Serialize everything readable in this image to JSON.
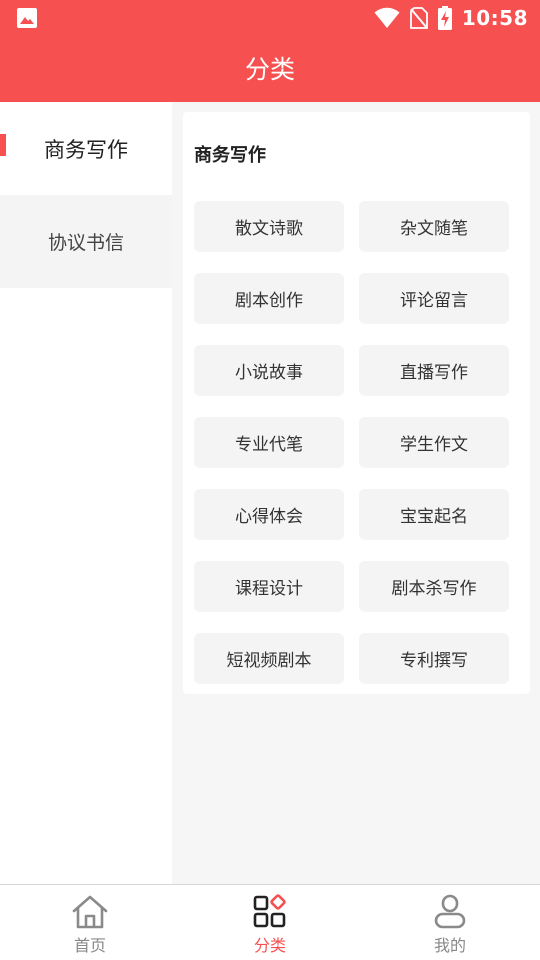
{
  "status_bar": {
    "time": "10:58"
  },
  "header": {
    "title": "分类"
  },
  "sidebar": {
    "items": [
      {
        "label": "商务写作",
        "active": true
      },
      {
        "label": "协议书信",
        "active": false
      }
    ]
  },
  "content": {
    "section_title": "商务写作",
    "tags": [
      "散文诗歌",
      "杂文随笔",
      "剧本创作",
      "评论留言",
      "小说故事",
      "直播写作",
      "专业代笔",
      "学生作文",
      "心得体会",
      "宝宝起名",
      "课程设计",
      "剧本杀写作",
      "短视频剧本",
      "专利撰写"
    ]
  },
  "tabbar": {
    "items": [
      {
        "label": "首页"
      },
      {
        "label": "分类"
      },
      {
        "label": "我的"
      }
    ]
  },
  "colors": {
    "accent": "#f65150",
    "inactive": "#888888"
  }
}
